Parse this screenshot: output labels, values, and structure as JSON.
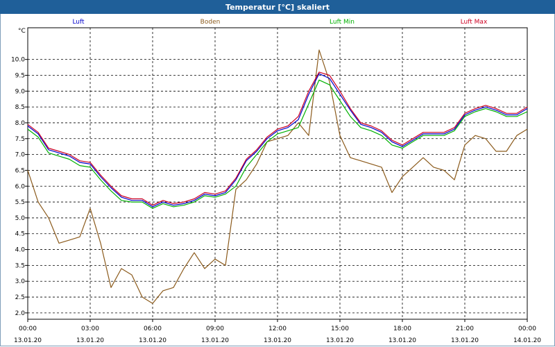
{
  "window": {
    "title": "Temperatur [°C] skaliert"
  },
  "chart_data": {
    "type": "line",
    "title": "Temperatur [°C] skaliert",
    "ylabel": "°C",
    "ylim": [
      1.8,
      11.0
    ],
    "yticks": [
      2.0,
      2.5,
      3.0,
      3.5,
      4.0,
      4.5,
      5.0,
      5.5,
      6.0,
      6.5,
      7.0,
      7.5,
      8.0,
      8.5,
      9.0,
      9.5,
      10.0
    ],
    "ytick_labels": [
      "2.0",
      "2.5",
      "3.0",
      "3.5",
      "4.0",
      "4.5",
      "5.0",
      "5.5",
      "6.0",
      "6.5",
      "7.0",
      "7.5",
      "8.0",
      "8.5",
      "9.0",
      "9.5",
      "10.0"
    ],
    "xlim": [
      0,
      24
    ],
    "xticks": [
      0,
      3,
      6,
      9,
      12,
      15,
      18,
      21,
      24
    ],
    "xtick_labels": [
      {
        "time": "00:00",
        "date": "13.01.20"
      },
      {
        "time": "03:00",
        "date": "13.01.20"
      },
      {
        "time": "06:00",
        "date": "13.01.20"
      },
      {
        "time": "09:00",
        "date": "13.01.20"
      },
      {
        "time": "12:00",
        "date": "13.01.20"
      },
      {
        "time": "15:00",
        "date": "13.01.20"
      },
      {
        "time": "18:00",
        "date": "13.01.20"
      },
      {
        "time": "21:00",
        "date": "13.01.20"
      },
      {
        "time": "00:00",
        "date": "14.01.20"
      }
    ],
    "grid": true,
    "legend_position": "top",
    "x_hours": [
      0,
      0.5,
      1,
      1.5,
      2,
      2.5,
      3,
      3.5,
      4,
      4.5,
      5,
      5.5,
      6,
      6.5,
      7,
      7.5,
      8,
      8.5,
      9,
      9.5,
      10,
      10.5,
      11,
      11.5,
      12,
      12.5,
      13,
      13.5,
      14,
      14.5,
      15,
      15.5,
      16,
      16.5,
      17,
      17.5,
      18,
      18.5,
      19,
      19.5,
      20,
      20.5,
      21,
      21.5,
      22,
      22.5,
      23,
      23.5,
      24
    ],
    "series": [
      {
        "name": "Luft",
        "color": "#0000cc",
        "values": [
          7.9,
          7.65,
          7.15,
          7.05,
          6.95,
          6.75,
          6.7,
          6.3,
          5.95,
          5.65,
          5.55,
          5.55,
          5.35,
          5.5,
          5.4,
          5.45,
          5.55,
          5.75,
          5.7,
          5.8,
          6.2,
          6.8,
          7.1,
          7.5,
          7.75,
          7.85,
          8.1,
          8.9,
          9.55,
          9.4,
          8.9,
          8.4,
          7.95,
          7.85,
          7.7,
          7.4,
          7.25,
          7.45,
          7.65,
          7.65,
          7.65,
          7.8,
          8.25,
          8.4,
          8.5,
          8.4,
          8.25,
          8.25,
          8.45
        ]
      },
      {
        "name": "Boden",
        "color": "#8b5a1b",
        "values": [
          6.5,
          5.5,
          5.0,
          4.2,
          4.3,
          4.4,
          5.3,
          4.2,
          2.8,
          3.4,
          3.2,
          2.5,
          2.3,
          2.7,
          2.8,
          3.4,
          3.9,
          3.4,
          3.7,
          3.5,
          5.9,
          6.2,
          6.7,
          7.4,
          7.5,
          7.6,
          8.0,
          7.6,
          10.3,
          9.3,
          7.6,
          6.9,
          6.8,
          6.7,
          6.6,
          5.8,
          6.3,
          6.6,
          6.9,
          6.6,
          6.5,
          6.2,
          7.3,
          7.6,
          7.5,
          7.1,
          7.1,
          7.6,
          7.8
        ]
      },
      {
        "name": "Luft Min",
        "color": "#00b000",
        "values": [
          7.8,
          7.55,
          7.05,
          6.95,
          6.85,
          6.65,
          6.6,
          6.2,
          5.85,
          5.55,
          5.5,
          5.5,
          5.3,
          5.45,
          5.35,
          5.4,
          5.5,
          5.7,
          5.65,
          5.75,
          6.0,
          6.6,
          7.0,
          7.4,
          7.65,
          7.75,
          7.85,
          8.6,
          9.35,
          9.2,
          8.7,
          8.2,
          7.85,
          7.75,
          7.6,
          7.3,
          7.2,
          7.4,
          7.6,
          7.6,
          7.6,
          7.75,
          8.2,
          8.35,
          8.45,
          8.35,
          8.2,
          8.2,
          8.35
        ]
      },
      {
        "name": "Luft Max",
        "color": "#cc0022",
        "values": [
          7.95,
          7.7,
          7.2,
          7.1,
          7.0,
          6.8,
          6.75,
          6.35,
          6.0,
          5.7,
          5.6,
          5.6,
          5.4,
          5.55,
          5.45,
          5.5,
          5.6,
          5.8,
          5.75,
          5.85,
          6.25,
          6.85,
          7.15,
          7.55,
          7.8,
          7.9,
          8.2,
          9.0,
          9.6,
          9.5,
          9.0,
          8.45,
          8.0,
          7.9,
          7.75,
          7.45,
          7.3,
          7.5,
          7.7,
          7.7,
          7.7,
          7.85,
          8.3,
          8.45,
          8.55,
          8.45,
          8.3,
          8.3,
          8.5
        ]
      }
    ]
  }
}
